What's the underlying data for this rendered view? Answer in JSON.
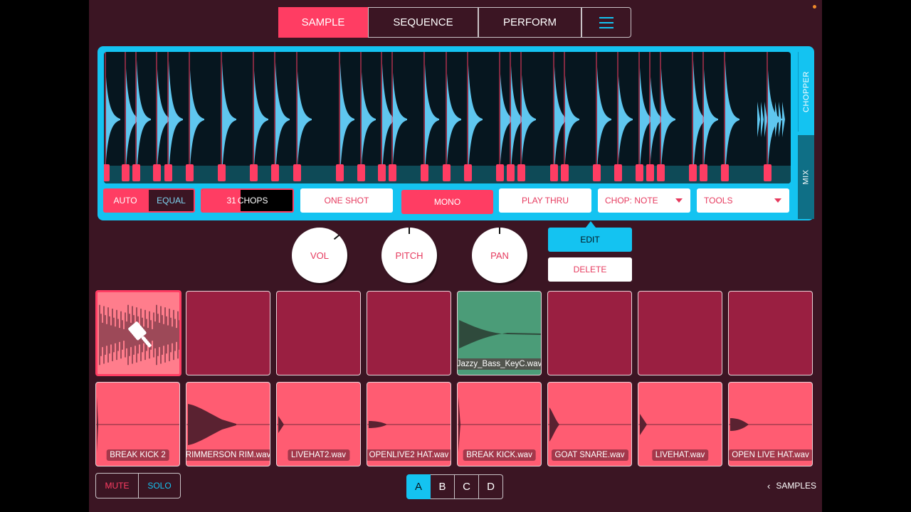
{
  "colors": {
    "background": "#3b1523",
    "accent_pink": "#ff3d63",
    "accent_cyan": "#14c3f1",
    "pad_empty": "#9a1f41",
    "pad_filled": "#ff5c72",
    "pad_green": "#4b9c78"
  },
  "tabs": [
    {
      "label": "SAMPLE",
      "active": true
    },
    {
      "label": "SEQUENCE",
      "active": false
    },
    {
      "label": "PERFORM",
      "active": false
    }
  ],
  "menu_icon": "hamburger-icon",
  "chopper": {
    "side_tabs": {
      "chopper": "CHOPPER",
      "mix": "MIX"
    },
    "auto_label": "AUTO",
    "equal_label": "EQUAL",
    "chops_count": "31",
    "chops_label": "CHOPS",
    "one_shot_label": "ONE SHOT",
    "mono_label": "MONO",
    "play_thru_label": "PLAY THRU",
    "chop_note_label": "CHOP: NOTE",
    "tools_label": "TOOLS"
  },
  "knobs": {
    "vol": "VOL",
    "pitch": "PITCH",
    "pan": "PAN"
  },
  "actions": {
    "edit": "EDIT",
    "delete": "DELETE"
  },
  "pads_top": [
    {
      "label": "",
      "state": "chopper-selected"
    },
    {
      "label": "",
      "state": "empty"
    },
    {
      "label": "",
      "state": "empty"
    },
    {
      "label": "",
      "state": "empty"
    },
    {
      "label": "Jazzy_Bass_KeyC.wav",
      "state": "green"
    },
    {
      "label": "",
      "state": "empty"
    },
    {
      "label": "",
      "state": "empty"
    },
    {
      "label": "",
      "state": "empty"
    }
  ],
  "pads_bottom": [
    {
      "label": "BREAK KICK 2"
    },
    {
      "label": "RIMMERSON RIM.wav"
    },
    {
      "label": "LIVEHAT2.wav"
    },
    {
      "label": "OPENLIVE2 HAT.wav"
    },
    {
      "label": "BREAK KICK.wav"
    },
    {
      "label": "GOAT SNARE.wav"
    },
    {
      "label": "LIVEHAT.wav"
    },
    {
      "label": "OPEN LIVE HAT.wav"
    }
  ],
  "footer": {
    "mute_label": "MUTE",
    "solo_label": "SOLO",
    "banks": [
      "A",
      "B",
      "C",
      "D"
    ],
    "active_bank": "A",
    "samples_label": "SAMPLES"
  }
}
